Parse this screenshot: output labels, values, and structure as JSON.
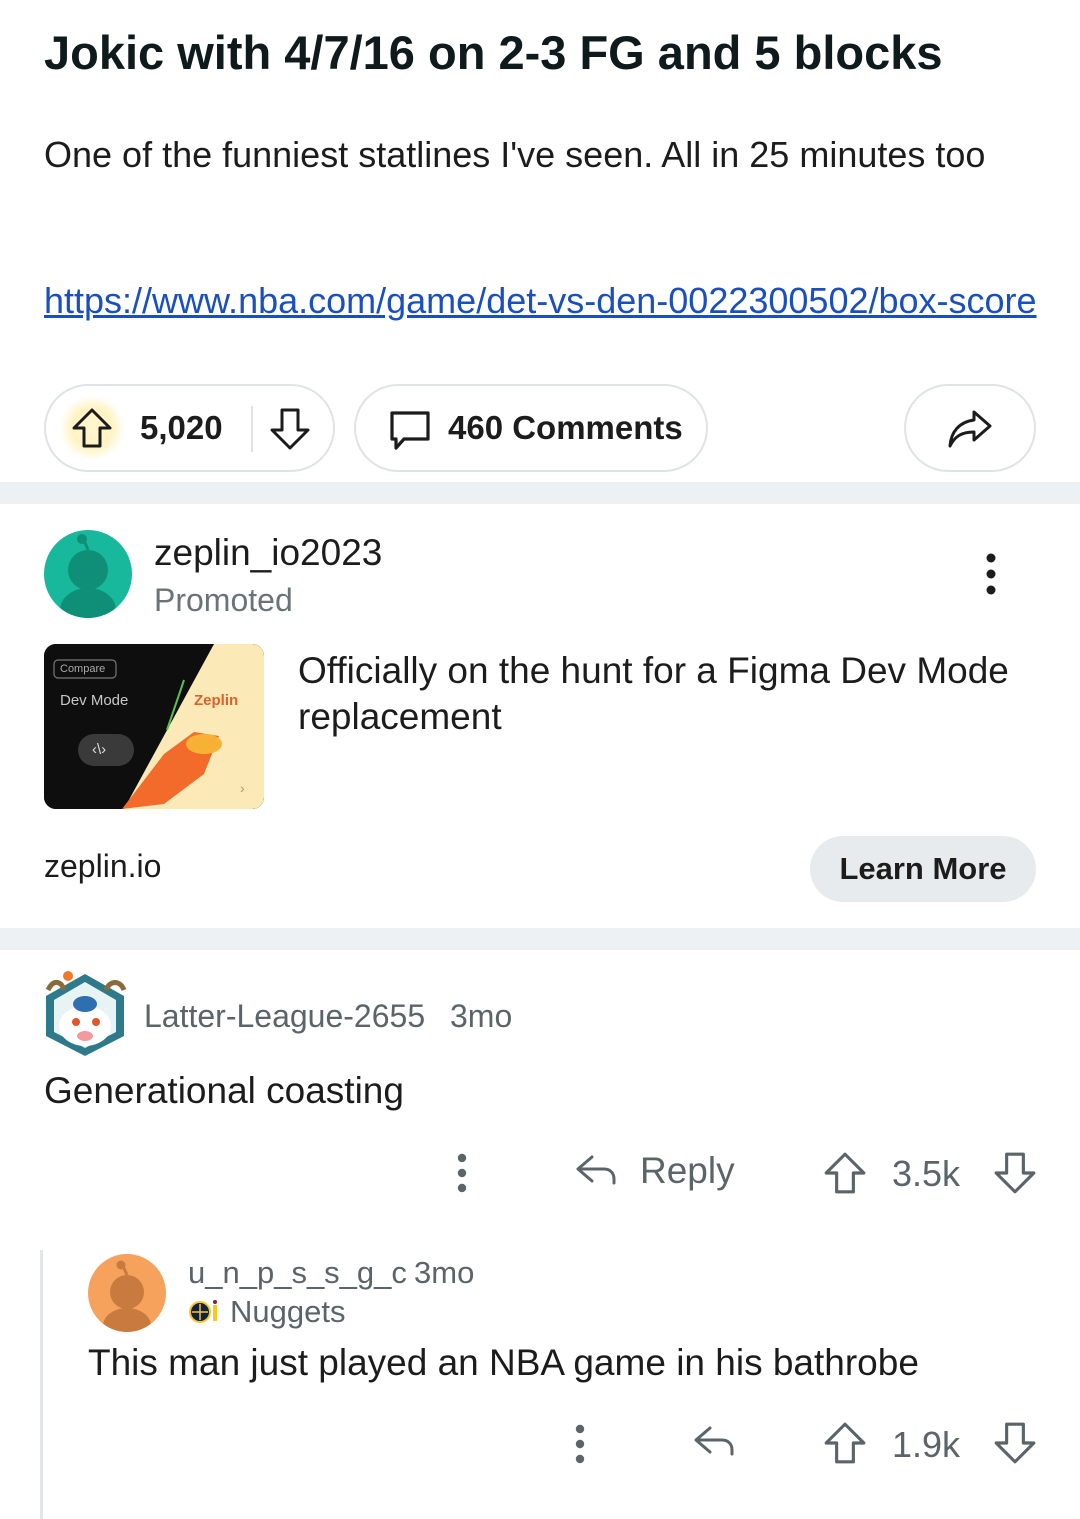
{
  "post": {
    "title": "Jokic with 4/7/16 on 2-3 FG and 5 blocks",
    "body": "One of the funniest statlines I've seen. All in 25 minutes too",
    "link": "https://www.nba.com/game/det-vs-den-0022300502/box-score",
    "votes": "5,020",
    "comments_label": "460 Comments",
    "upvote_icon": "arrow-up-outline-icon",
    "downvote_icon": "arrow-down-outline-icon",
    "comment_icon": "speech-bubble-icon",
    "share_icon": "share-arrow-icon"
  },
  "ad": {
    "username": "zeplin_io2023",
    "label": "Promoted",
    "headline": "Officially on the hunt for a Figma Dev Mode replacement",
    "domain": "zeplin.io",
    "cta": "Learn More",
    "thumb": {
      "tag": "Compare",
      "left_text": "Dev Mode",
      "right_text": "Zeplin",
      "code_glyph": "‹\\›",
      "arrow": "›"
    },
    "avatar_color": "#17b89c"
  },
  "comments": [
    {
      "username": "Latter-League-2655",
      "time": "3mo",
      "body": "Generational coasting",
      "reply_label": "Reply",
      "score": "3.5k"
    },
    {
      "username": "u_n_p_s_s_g_c",
      "time": "3mo",
      "flair": "Nuggets",
      "body": "This man just played an NBA game in his bathrobe",
      "score": "1.9k",
      "avatar_color": "#f7a25c"
    }
  ],
  "colors": {
    "link": "#1a4fbf",
    "muted": "#5b6468",
    "divider": "#eef1f3"
  }
}
